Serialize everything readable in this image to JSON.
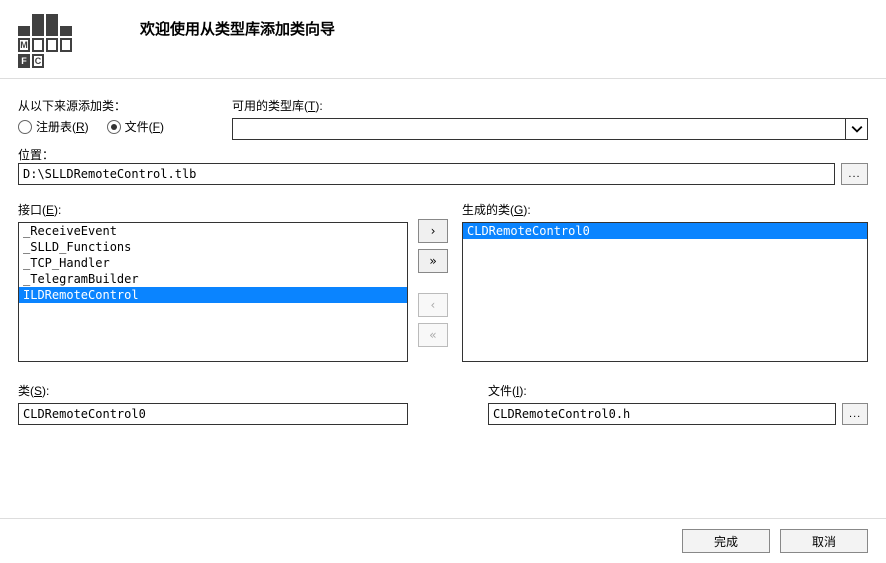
{
  "header": {
    "title": "欢迎使用从类型库添加类向导"
  },
  "source": {
    "label": "从以下来源添加类：",
    "registry_label_pre": "注册表(",
    "registry_hotkey": "R",
    "registry_label_post": ")",
    "file_label_pre": "文件(",
    "file_hotkey": "F",
    "file_label_post": ")",
    "selected": "file"
  },
  "typelib": {
    "label_pre": "可用的类型库(",
    "label_hotkey": "T",
    "label_post": "):",
    "value": ""
  },
  "location": {
    "label": "位置：",
    "value": "D:\\SLLDRemoteControl.tlb"
  },
  "interfaces": {
    "label_pre": "接口(",
    "label_hotkey": "E",
    "label_post": "):",
    "items": [
      {
        "text": "_ReceiveEvent",
        "selected": false
      },
      {
        "text": "_SLLD_Functions",
        "selected": false
      },
      {
        "text": "_TCP_Handler",
        "selected": false
      },
      {
        "text": "_TelegramBuilder",
        "selected": false
      },
      {
        "text": "ILDRemoteControl",
        "selected": true
      }
    ]
  },
  "buttons": {
    "add": "›",
    "add_all": "»",
    "remove": "‹",
    "remove_all": "«"
  },
  "generated": {
    "label_pre": "生成的类(",
    "label_hotkey": "G",
    "label_post": "):",
    "items": [
      {
        "text": "CLDRemoteControl0",
        "selected": true
      }
    ]
  },
  "class_field": {
    "label_pre": "类(",
    "label_hotkey": "S",
    "label_post": "):",
    "value": "CLDRemoteControl0"
  },
  "file_field": {
    "label_pre": "文件(",
    "label_hotkey": "I",
    "label_post": "):",
    "value": "CLDRemoteControl0.h"
  },
  "footer": {
    "finish": "完成",
    "cancel": "取消"
  },
  "browse_label": "..."
}
